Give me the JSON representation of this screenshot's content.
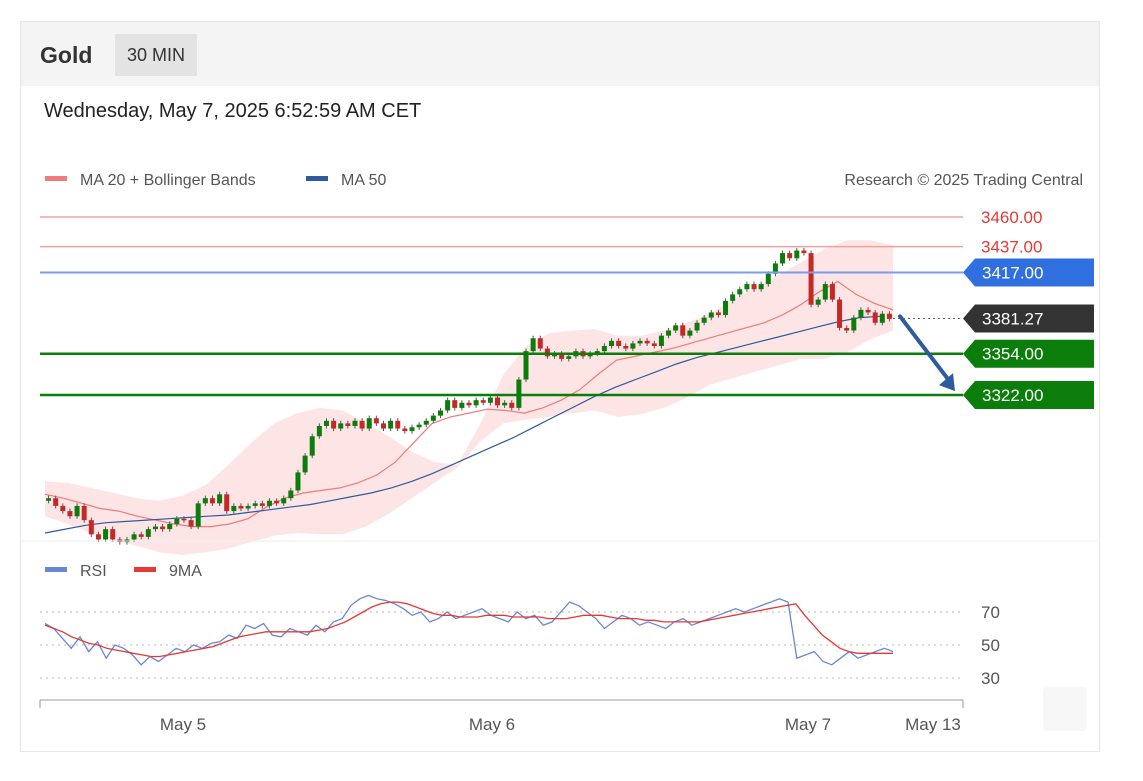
{
  "header": {
    "instrument": "Gold",
    "timeframe": "30 MIN"
  },
  "datetime": "Wednesday, May 7, 2025 6:52:59 AM CET",
  "copyright": "Research © 2025 Trading Central",
  "colors": {
    "ma20": "#f07b7b",
    "bollinger_fill": "#fde0e0",
    "ma50": "#2e5a9e",
    "resistance": "#f4a0a0",
    "pivot": "#2f6fe0",
    "support": "#0a7d0a",
    "current": "#333333",
    "arrow": "#2e5a9e",
    "candle_up": "#0a7d0a",
    "candle_down": "#c62828",
    "rsi": "#6a86d8",
    "rsi_ma": "#e53935"
  },
  "chart_data": [
    {
      "type": "candlestick",
      "legend": [
        {
          "name": "MA 20 + Bollinger Bands",
          "color": "#f07b7b"
        },
        {
          "name": "MA 50",
          "color": "#2e5a9e"
        }
      ],
      "price_levels": [
        {
          "label": "3460.00",
          "value": 3460.0,
          "kind": "resistance"
        },
        {
          "label": "3437.00",
          "value": 3437.0,
          "kind": "resistance"
        },
        {
          "label": "3417.00",
          "value": 3417.0,
          "kind": "pivot"
        },
        {
          "label": "3381.27",
          "value": 3381.27,
          "kind": "current"
        },
        {
          "label": "3354.00",
          "value": 3354.0,
          "kind": "support"
        },
        {
          "label": "3322.00",
          "value": 3322.0,
          "kind": "support"
        }
      ],
      "x_ticks": [
        "May 5",
        "May 6",
        "May 7",
        "May 13"
      ],
      "ylim": [
        3190,
        3475
      ],
      "forecast_arrow": {
        "from": 3383,
        "to": 3325
      },
      "ma20": [
        3245,
        3242,
        3238,
        3234,
        3232,
        3228,
        3225,
        3222,
        3220,
        3220,
        3222,
        3226,
        3235,
        3242,
        3246,
        3248,
        3250,
        3254,
        3260,
        3270,
        3285,
        3300,
        3305,
        3308,
        3311,
        3310,
        3308,
        3312,
        3318,
        3326,
        3338,
        3349,
        3352,
        3355,
        3358,
        3362,
        3366,
        3370,
        3374,
        3378,
        3384,
        3392,
        3402,
        3410,
        3400,
        3393,
        3388
      ],
      "ma50": [
        3215,
        3218,
        3221,
        3223,
        3224,
        3225,
        3226,
        3227,
        3228,
        3229,
        3231,
        3233,
        3235,
        3237,
        3240,
        3243,
        3246,
        3250,
        3255,
        3261,
        3268,
        3275,
        3282,
        3289,
        3297,
        3305,
        3313,
        3321,
        3328,
        3334,
        3340,
        3346,
        3351,
        3355,
        3359,
        3363,
        3367,
        3371,
        3375,
        3379,
        3382,
        3383
      ],
      "bollinger_upper": [
        3255,
        3254,
        3250,
        3246,
        3242,
        3240,
        3244,
        3252,
        3268,
        3285,
        3300,
        3308,
        3312,
        3310,
        3300,
        3290,
        3278,
        3270,
        3268,
        3300,
        3338,
        3360,
        3370,
        3372,
        3373,
        3368,
        3368,
        3372,
        3378,
        3385,
        3396,
        3405,
        3415,
        3425,
        3435,
        3442,
        3442,
        3438
      ],
      "bollinger_lower": [
        3228,
        3222,
        3215,
        3210,
        3205,
        3200,
        3198,
        3200,
        3203,
        3208,
        3213,
        3215,
        3214,
        3214,
        3220,
        3230,
        3242,
        3254,
        3266,
        3286,
        3300,
        3303,
        3305,
        3308,
        3310,
        3305,
        3307,
        3312,
        3320,
        3330,
        3335,
        3340,
        3345,
        3350,
        3350,
        3355,
        3365,
        3372
      ],
      "candles": [
        [
          3240,
          3242
        ],
        [
          3242,
          3236
        ],
        [
          3236,
          3232
        ],
        [
          3232,
          3228
        ],
        [
          3228,
          3236
        ],
        [
          3236,
          3225
        ],
        [
          3225,
          3214
        ],
        [
          3214,
          3210
        ],
        [
          3210,
          3218
        ],
        [
          3218,
          3210
        ],
        [
          3210,
          3208
        ],
        [
          3208,
          3210
        ],
        [
          3210,
          3214
        ],
        [
          3214,
          3212
        ],
        [
          3212,
          3218
        ],
        [
          3218,
          3220
        ],
        [
          3220,
          3218
        ],
        [
          3218,
          3222
        ],
        [
          3222,
          3226
        ],
        [
          3226,
          3225
        ],
        [
          3225,
          3220
        ],
        [
          3220,
          3238
        ],
        [
          3238,
          3242
        ],
        [
          3242,
          3238
        ],
        [
          3238,
          3245
        ],
        [
          3245,
          3232
        ],
        [
          3232,
          3236
        ],
        [
          3236,
          3234
        ],
        [
          3234,
          3236
        ],
        [
          3236,
          3238
        ],
        [
          3238,
          3236
        ],
        [
          3236,
          3240
        ],
        [
          3240,
          3238
        ],
        [
          3238,
          3242
        ],
        [
          3242,
          3248
        ],
        [
          3248,
          3262
        ],
        [
          3262,
          3275
        ],
        [
          3275,
          3290
        ],
        [
          3290,
          3298
        ],
        [
          3298,
          3302
        ],
        [
          3302,
          3296
        ],
        [
          3296,
          3300
        ],
        [
          3300,
          3298
        ],
        [
          3298,
          3302
        ],
        [
          3302,
          3296
        ],
        [
          3296,
          3304
        ],
        [
          3304,
          3300
        ],
        [
          3300,
          3296
        ],
        [
          3296,
          3302
        ],
        [
          3302,
          3296
        ],
        [
          3296,
          3294
        ],
        [
          3294,
          3297
        ],
        [
          3297,
          3299
        ],
        [
          3299,
          3302
        ],
        [
          3302,
          3306
        ],
        [
          3306,
          3310
        ],
        [
          3310,
          3318
        ],
        [
          3318,
          3312
        ],
        [
          3312,
          3316
        ],
        [
          3316,
          3314
        ],
        [
          3314,
          3318
        ],
        [
          3318,
          3316
        ],
        [
          3316,
          3320
        ],
        [
          3320,
          3314
        ],
        [
          3314,
          3316
        ],
        [
          3316,
          3312
        ],
        [
          3312,
          3334
        ],
        [
          3334,
          3356
        ],
        [
          3356,
          3366
        ],
        [
          3366,
          3358
        ],
        [
          3358,
          3352
        ],
        [
          3352,
          3354
        ],
        [
          3354,
          3350
        ],
        [
          3350,
          3352
        ],
        [
          3352,
          3356
        ],
        [
          3356,
          3352
        ],
        [
          3352,
          3354
        ],
        [
          3354,
          3356
        ],
        [
          3356,
          3360
        ],
        [
          3360,
          3364
        ],
        [
          3364,
          3360
        ],
        [
          3360,
          3358
        ],
        [
          3358,
          3362
        ],
        [
          3362,
          3364
        ],
        [
          3364,
          3362
        ],
        [
          3362,
          3360
        ],
        [
          3360,
          3368
        ],
        [
          3368,
          3372
        ],
        [
          3372,
          3376
        ],
        [
          3376,
          3368
        ],
        [
          3368,
          3372
        ],
        [
          3372,
          3378
        ],
        [
          3378,
          3382
        ],
        [
          3382,
          3386
        ],
        [
          3386,
          3384
        ],
        [
          3384,
          3395
        ],
        [
          3395,
          3400
        ],
        [
          3400,
          3404
        ],
        [
          3404,
          3408
        ],
        [
          3408,
          3404
        ],
        [
          3404,
          3408
        ],
        [
          3408,
          3416
        ],
        [
          3416,
          3424
        ],
        [
          3424,
          3432
        ],
        [
          3432,
          3428
        ],
        [
          3428,
          3434
        ],
        [
          3434,
          3432
        ],
        [
          3432,
          3392
        ],
        [
          3392,
          3396
        ],
        [
          3396,
          3408
        ],
        [
          3408,
          3396
        ],
        [
          3396,
          3374
        ],
        [
          3374,
          3372
        ],
        [
          3372,
          3382
        ],
        [
          3382,
          3388
        ],
        [
          3388,
          3386
        ],
        [
          3386,
          3378
        ],
        [
          3378,
          3385
        ],
        [
          3385,
          3381
        ]
      ]
    },
    {
      "type": "line",
      "legend": [
        {
          "name": "RSI",
          "color": "#6a86d8"
        },
        {
          "name": "9MA",
          "color": "#e53935"
        }
      ],
      "y_ticks": [
        70,
        50,
        30
      ],
      "ylim": [
        20,
        80
      ],
      "rsi": [
        63,
        60,
        54,
        48,
        55,
        46,
        52,
        42,
        50,
        48,
        44,
        38,
        43,
        40,
        44,
        48,
        46,
        50,
        48,
        51,
        52,
        56,
        54,
        62,
        60,
        63,
        56,
        55,
        60,
        58,
        56,
        62,
        58,
        64,
        66,
        74,
        78,
        80,
        78,
        77,
        75,
        72,
        68,
        70,
        64,
        66,
        70,
        66,
        68,
        70,
        72,
        68,
        66,
        64,
        70,
        66,
        68,
        62,
        64,
        70,
        76,
        74,
        70,
        66,
        60,
        64,
        68,
        66,
        62,
        64,
        62,
        60,
        64,
        66,
        62,
        64,
        66,
        68,
        70,
        72,
        70,
        72,
        74,
        76,
        78,
        76,
        42,
        44,
        46,
        40,
        38,
        42,
        46,
        42,
        44,
        46,
        48,
        46
      ],
      "rsi_ma": [
        62,
        60,
        58,
        55,
        53,
        51,
        50,
        48,
        47,
        46,
        45,
        44,
        43,
        43,
        44,
        45,
        46,
        47,
        48,
        49,
        51,
        53,
        55,
        56,
        57,
        58,
        58,
        58,
        58,
        58,
        58,
        59,
        60,
        62,
        64,
        67,
        70,
        73,
        75,
        76,
        76,
        75,
        73,
        71,
        69,
        68,
        68,
        67,
        67,
        67,
        68,
        68,
        68,
        67,
        67,
        67,
        67,
        66,
        66,
        66,
        67,
        68,
        68,
        68,
        67,
        66,
        66,
        66,
        65,
        65,
        64,
        64,
        64,
        64,
        64,
        65,
        66,
        67,
        68,
        69,
        70,
        71,
        72,
        73,
        74,
        75,
        68,
        62,
        56,
        52,
        48,
        46,
        45,
        45,
        45,
        45,
        45
      ]
    }
  ]
}
